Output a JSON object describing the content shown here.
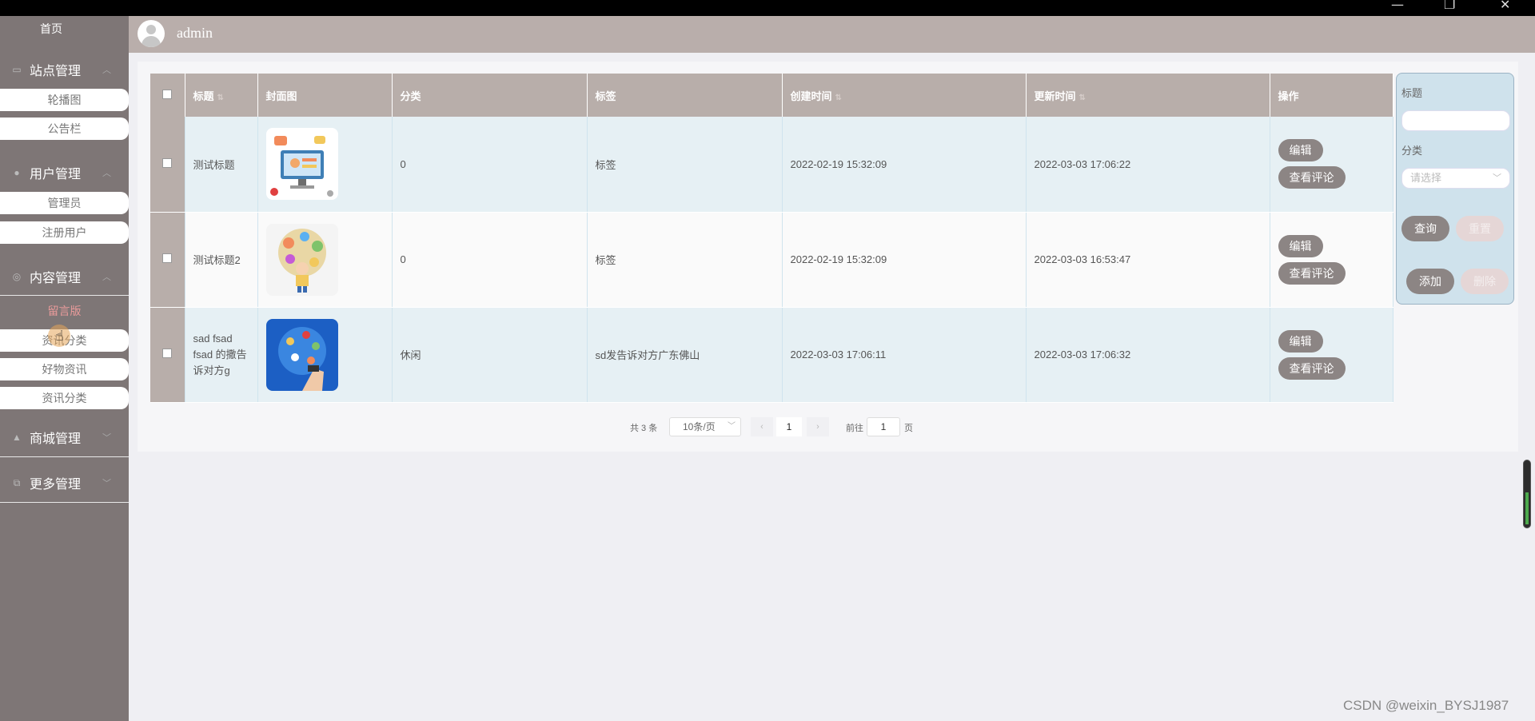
{
  "sidebar": {
    "home": "首页",
    "groups": [
      {
        "label": "站点管理",
        "items": [
          "轮播图",
          "公告栏"
        ]
      },
      {
        "label": "用户管理",
        "items": [
          "管理员",
          "注册用户"
        ]
      },
      {
        "label": "内容管理",
        "items": [
          "留言版",
          "资讯分类",
          "好物资讯",
          "资讯分类"
        ]
      },
      {
        "label": "商城管理",
        "items": []
      },
      {
        "label": "更多管理",
        "items": []
      }
    ]
  },
  "header": {
    "username": "admin"
  },
  "table": {
    "columns": [
      "标题",
      "封面图",
      "分类",
      "标签",
      "创建时间",
      "更新时间",
      "操作"
    ],
    "rows": [
      {
        "title": "测试标题",
        "category": "0",
        "tag": "标签",
        "created": "2022-02-19 15:32:09",
        "updated": "2022-03-03 17:06:22"
      },
      {
        "title": "测试标题2",
        "category": "0",
        "tag": "标签",
        "created": "2022-02-19 15:32:09",
        "updated": "2022-03-03 16:53:47"
      },
      {
        "title": "sad fsad fsad 的撒告诉对方g",
        "category": "休闲",
        "tag": "sd发告诉对方广东佛山",
        "created": "2022-03-03 17:06:11",
        "updated": "2022-03-03 17:06:32"
      }
    ],
    "edit_label": "编辑",
    "comments_label": "查看评论"
  },
  "filter": {
    "title_label": "标题",
    "category_label": "分类",
    "category_placeholder": "请选择",
    "query_label": "查询",
    "reset_label": "重置",
    "add_label": "添加",
    "delete_label": "删除"
  },
  "pagination": {
    "total": "共 3 条",
    "page_size": "10条/页",
    "current_page": "1",
    "goto_label": "前往",
    "goto_value": "1",
    "page_suffix": "页"
  },
  "watermark": "CSDN @weixin_BYSJ1987",
  "colors": {
    "sidebar": "#7e7676",
    "header": "#b9aeab",
    "button": "#8c8584",
    "filter_panel": "#cfe2ec"
  }
}
